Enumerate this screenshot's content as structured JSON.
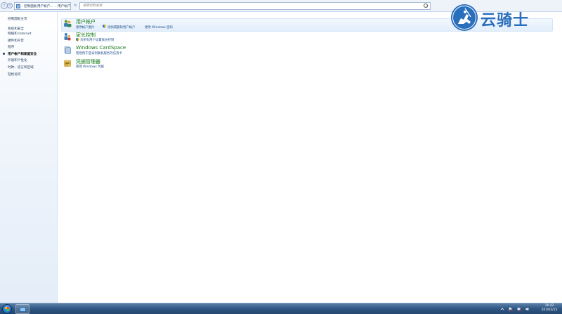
{
  "address": {
    "crumbs": [
      "控制面板",
      "用户帐户...",
      "用户帐户"
    ],
    "search_placeholder": "搜索控制面板"
  },
  "left_nav": {
    "home": "控制面板主页",
    "items": [
      {
        "label": "系统和安全",
        "current": false
      },
      {
        "label": "网络和 Internet",
        "current": false
      },
      {
        "label": "硬件和声音",
        "current": false
      },
      {
        "label": "程序",
        "current": false
      },
      {
        "label": "用户帐户和家庭安全",
        "current": true
      },
      {
        "label": "外观和个性化",
        "current": false
      },
      {
        "label": "时钟、语言和区域",
        "current": false
      },
      {
        "label": "轻松访问",
        "current": false
      }
    ]
  },
  "categories": [
    {
      "title": "用户帐户",
      "links": [
        "更改帐户图片",
        "添加或删除用户帐户",
        "更改 Windows 密码"
      ],
      "icon": "users-icon"
    },
    {
      "title": "家长控制",
      "links": [
        "为所有用户设置家长控制"
      ],
      "icon": "parental-control-icon"
    },
    {
      "title": "Windows CardSpace",
      "links": [
        "管理用于登录到联机服务的信息卡"
      ],
      "icon": "cardspace-icon"
    },
    {
      "title": "凭据管理器",
      "links": [
        "管理 Windows 凭据"
      ],
      "icon": "credential-manager-icon"
    }
  ],
  "watermark": {
    "text": "云骑士"
  },
  "taskbar": {
    "time": "16:42",
    "date": "2019/3/15"
  },
  "colors": {
    "link_green": "#197b1e",
    "link_blue": "#1e4e8c",
    "taskbar": "#2f5683",
    "watermark": "#2a6fbc"
  }
}
